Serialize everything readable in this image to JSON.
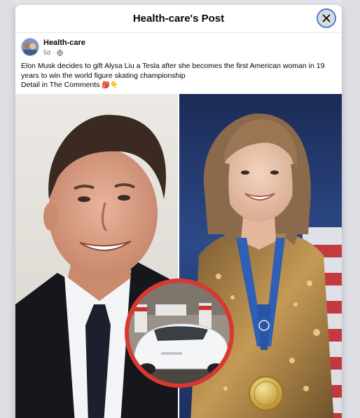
{
  "dialog": {
    "title": "Health-care's Post"
  },
  "post": {
    "author": "Health-care",
    "time": "5d",
    "separator": "·",
    "text_line1": "Elon Musk decides to gift Alysa Liu a Tesla after she becomes the first American woman in 19 years to win the world figure skating championship",
    "text_line2": "Detail in The Comments",
    "text_emoji": "🎒👇"
  },
  "icons": {
    "close": "close-icon",
    "audience": "globe-icon"
  },
  "colors": {
    "close_ring": "#4e7dd6",
    "tesla_red": "#cc2b2b",
    "medal_ribbon": "#2f5fb6",
    "medal_gold": "#d9b44a"
  }
}
